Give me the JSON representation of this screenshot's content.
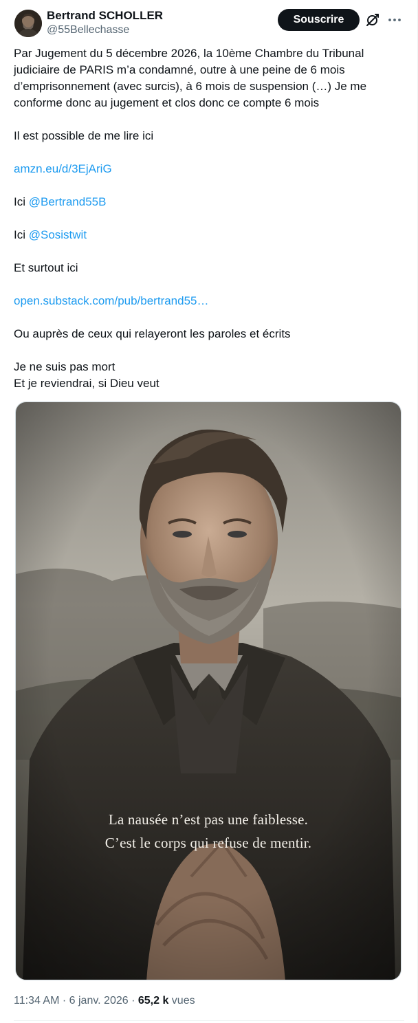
{
  "author": {
    "display_name": "Bertrand SCHOLLER",
    "handle": "@55Bellechasse",
    "avatar_icon": "profile-avatar"
  },
  "actions": {
    "subscribe_label": "Souscrire",
    "grok_icon": "grok-icon",
    "more_icon": "more-icon"
  },
  "tweet": {
    "paragraphs": [
      "Par Jugement du 5 décembre 2026, la 10ème Chambre du Tribunal judiciaire de PARIS m’a condamné, outre à une peine de 6 mois d’emprisonnement (avec surcis), à 6 mois de suspension (…) Je me conforme donc au jugement et clos donc ce compte 6 mois",
      "Il est possible de me lire ici"
    ],
    "link_amazon": "amzn.eu/d/3EjAriG",
    "ici_1_prefix": "Ici ",
    "mention_1": "@Bertrand55B",
    "ici_2_prefix": "Ici ",
    "mention_2": "@Sosistwit",
    "surtout": "Et surtout ici",
    "link_substack": "open.substack.com/pub/bertrand55…",
    "relay": "Ou auprès de ceux qui relayeront les paroles et écrits",
    "closing_1": "Je ne suis pas mort",
    "closing_2": "Et je reviendrai, si Dieu veut"
  },
  "media": {
    "caption_line_1": "La nausée n’est pas une faiblesse.",
    "caption_line_2": "C’est le corps qui refuse de mentir."
  },
  "meta": {
    "time": "11:34 AM",
    "sep1": " · ",
    "date": "6 janv. 2026",
    "sep2": " · ",
    "views_count": "65,2 k",
    "views_label": " vues"
  },
  "colors": {
    "link": "#1d9bf0",
    "text": "#0f1419",
    "secondary": "#536471",
    "button_bg": "#0f1419"
  }
}
